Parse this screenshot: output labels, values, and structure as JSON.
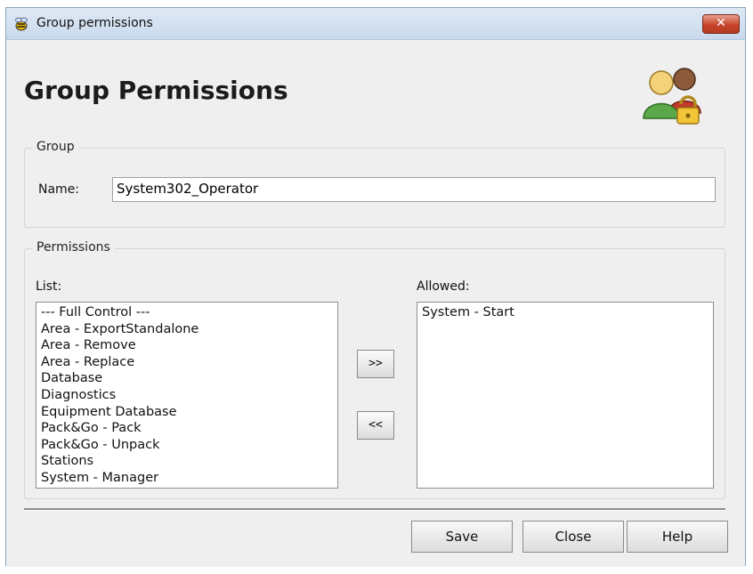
{
  "window": {
    "title": "Group permissions",
    "close_glyph": "✕",
    "app_icon": "bee-icon"
  },
  "header": {
    "title": "Group Permissions",
    "icon": "users-lock-icon"
  },
  "group": {
    "legend": "Group",
    "name_label": "Name:",
    "name_value": "System302_Operator"
  },
  "permissions": {
    "legend": "Permissions",
    "list_label": "List:",
    "allowed_label": "Allowed:",
    "list_items": [
      "--- Full Control ---",
      "Area - ExportStandalone",
      "Area - Remove",
      "Area - Replace",
      "Database",
      "Diagnostics",
      "Equipment Database",
      "Pack&Go - Pack",
      "Pack&Go - Unpack",
      "Stations",
      "System - Manager"
    ],
    "allowed_items": [
      "System - Start"
    ],
    "add_label": ">>",
    "remove_label": "<<"
  },
  "footer": {
    "save_label": "Save",
    "close_label": "Close",
    "help_label": "Help"
  }
}
